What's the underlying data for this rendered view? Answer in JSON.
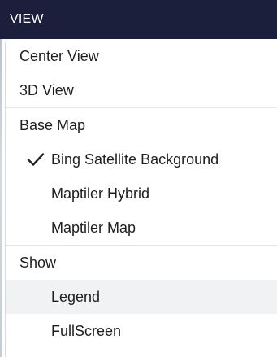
{
  "header": {
    "title": "VIEW"
  },
  "menu": {
    "view_items": [
      {
        "label": "Center View"
      },
      {
        "label": "3D View"
      }
    ],
    "base_map": {
      "label": "Base Map",
      "options": [
        {
          "label": "Bing Satellite Background",
          "checked": true
        },
        {
          "label": "Maptiler Hybrid",
          "checked": false
        },
        {
          "label": "Maptiler Map",
          "checked": false
        }
      ]
    },
    "show": {
      "label": "Show",
      "options": [
        {
          "label": "Legend"
        },
        {
          "label": "FullScreen"
        }
      ]
    }
  },
  "icons": {
    "checkmark": "checkmark-icon"
  }
}
